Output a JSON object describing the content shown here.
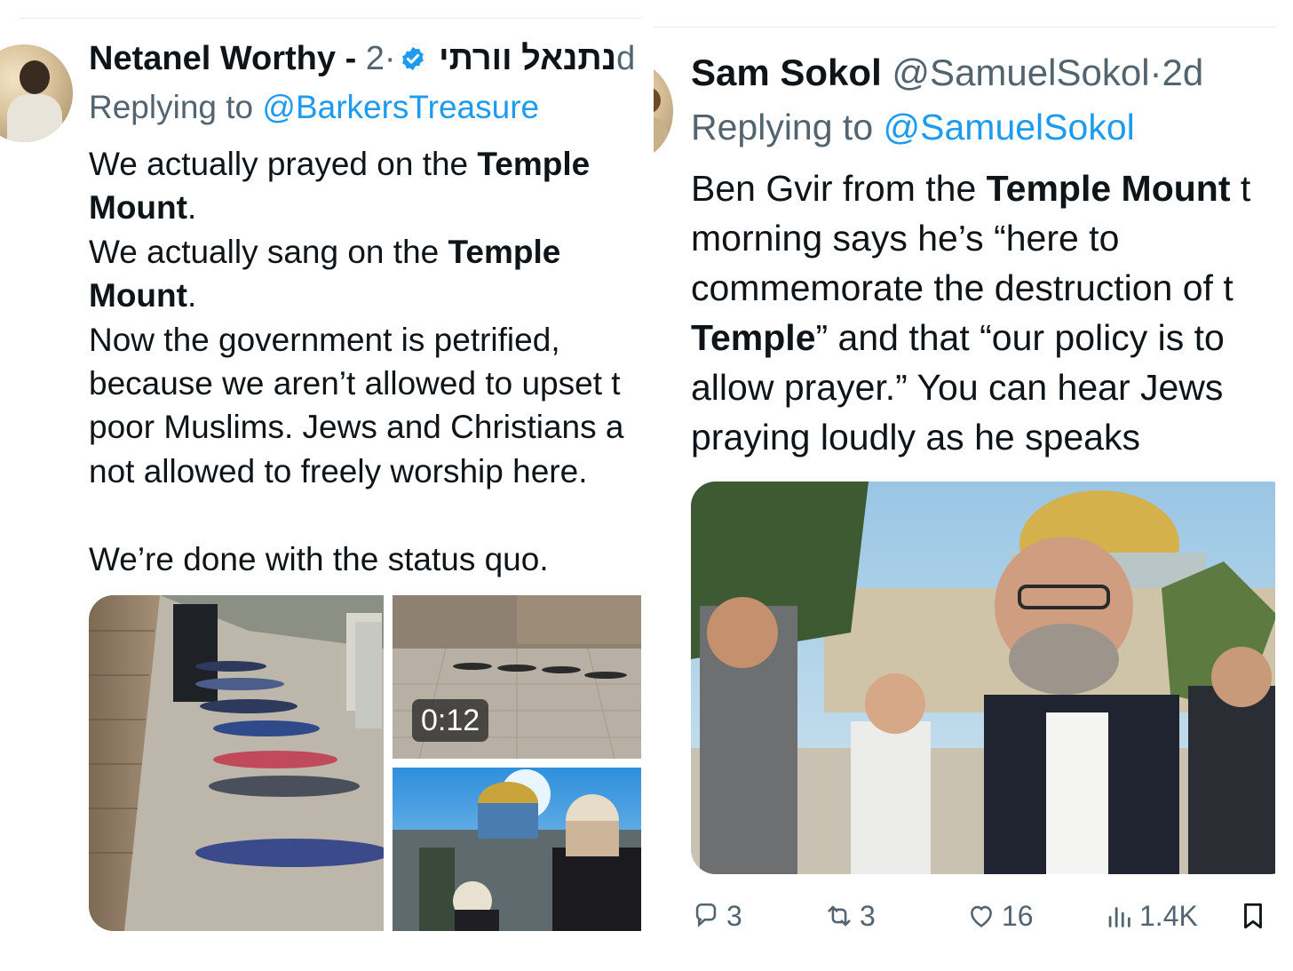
{
  "left_tweet": {
    "author_name": "Netanel Worthy - נתנאל וורתי",
    "separator": "·",
    "time": "2d",
    "replying_prefix": "Replying to",
    "replying_to": "@BarkersTreasure",
    "text_lines": [
      {
        "a": "We actually prayed on the ",
        "b": "Temple",
        "c": ""
      },
      {
        "a": "",
        "b": "Mount",
        "c": "."
      },
      {
        "a": "We actually sang on the ",
        "b": "Temple",
        "c": ""
      },
      {
        "a": "",
        "b": "Mount",
        "c": "."
      },
      {
        "a": "Now the government is petrified,",
        "b": "",
        "c": ""
      },
      {
        "a": "because we aren’t allowed to upset t",
        "b": "",
        "c": ""
      },
      {
        "a": "poor Muslims. Jews and Christians a",
        "b": "",
        "c": ""
      },
      {
        "a": "not allowed to freely worship here.",
        "b": "",
        "c": ""
      },
      {
        "a": "",
        "b": "",
        "c": ""
      },
      {
        "a": "We’re done with the status quo.",
        "b": "",
        "c": ""
      }
    ],
    "video_duration": "0:12"
  },
  "right_tweet": {
    "author_name": "Sam Sokol",
    "handle": "@SamuelSokol",
    "separator": "·",
    "time": "2d",
    "replying_prefix": "Replying to",
    "replying_to": "@SamuelSokol",
    "text_lines": [
      {
        "a": "Ben Gvir from the ",
        "b": "Temple Mount",
        "c": " t"
      },
      {
        "a": "morning says he’s “here to",
        "b": "",
        "c": ""
      },
      {
        "a": "commemorate the destruction of t",
        "b": "",
        "c": ""
      },
      {
        "a": "",
        "b": "Temple",
        "c": "” and that “our policy is to"
      },
      {
        "a": "allow prayer.” You can hear Jews",
        "b": "",
        "c": ""
      },
      {
        "a": "praying loudly as he speaks",
        "b": "",
        "c": ""
      }
    ],
    "actions": {
      "replies": "3",
      "reposts": "3",
      "likes": "16",
      "views": "1.4K"
    }
  },
  "colors": {
    "text": "#0f1419",
    "muted": "#536471",
    "link": "#1d9bf0",
    "verified": "#1d9bf0"
  }
}
